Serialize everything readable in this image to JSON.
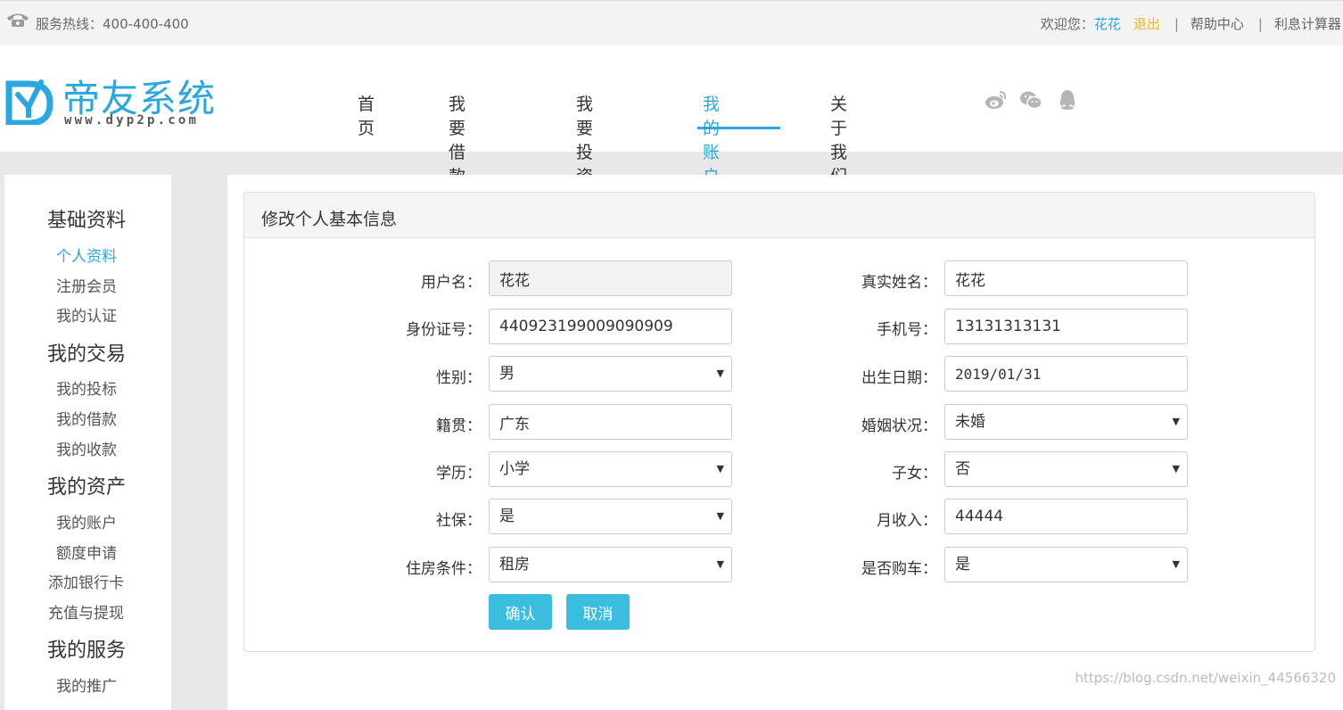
{
  "topbar": {
    "hotline": "服务热线：400-400-400",
    "welcome": "欢迎您：",
    "username": "花花",
    "logout": "退出",
    "help": "帮助中心",
    "calculator": "利息计算器"
  },
  "brand": {
    "name": "帝友系统",
    "url": "www.dyp2p.com",
    "color": "#2aa7e0"
  },
  "nav": {
    "items": [
      "首页",
      "我要借款",
      "我要投资",
      "我的账户",
      "关于我们"
    ],
    "active": "我的账户",
    "social_icons": [
      "weibo-icon",
      "wechat-icon",
      "qq-icon"
    ]
  },
  "sidebar": {
    "groups": [
      {
        "title": "基础资料",
        "items": [
          "个人资料",
          "注册会员",
          "我的认证"
        ]
      },
      {
        "title": "我的交易",
        "items": [
          "我的投标",
          "我的借款",
          "我的收款"
        ]
      },
      {
        "title": "我的资产",
        "items": [
          "我的账户",
          "额度申请",
          "添加银行卡",
          "充值与提现"
        ]
      },
      {
        "title": "我的服务",
        "items": [
          "我的推广"
        ]
      }
    ],
    "active_item": "个人资料"
  },
  "form": {
    "title": "修改个人基本信息",
    "username_label": "用户名：",
    "username": "花花",
    "realname_label": "真实姓名：",
    "realname": "花花",
    "idcard_label": "身份证号：",
    "idcard": "440923199009090909",
    "phone_label": "手机号：",
    "phone": "13131313131",
    "gender_label": "性别：",
    "gender": "男",
    "birthday_label": "出生日期：",
    "birthday": "2019/01/31",
    "hometown_label": "籍贯：",
    "hometown": "广东",
    "marital_label": "婚姻状况：",
    "marital": "未婚",
    "education_label": "学历：",
    "education": "小学",
    "children_label": "子女：",
    "children": "否",
    "insurance_label": "社保：",
    "insurance": "是",
    "income_label": "月收入：",
    "income": "44444",
    "housing_label": "住房条件：",
    "housing": "租房",
    "car_label": "是否购车：",
    "car": "是",
    "confirm": "确认",
    "cancel": "取消"
  },
  "watermark": "https://blog.csdn.net/weixin_44566320"
}
